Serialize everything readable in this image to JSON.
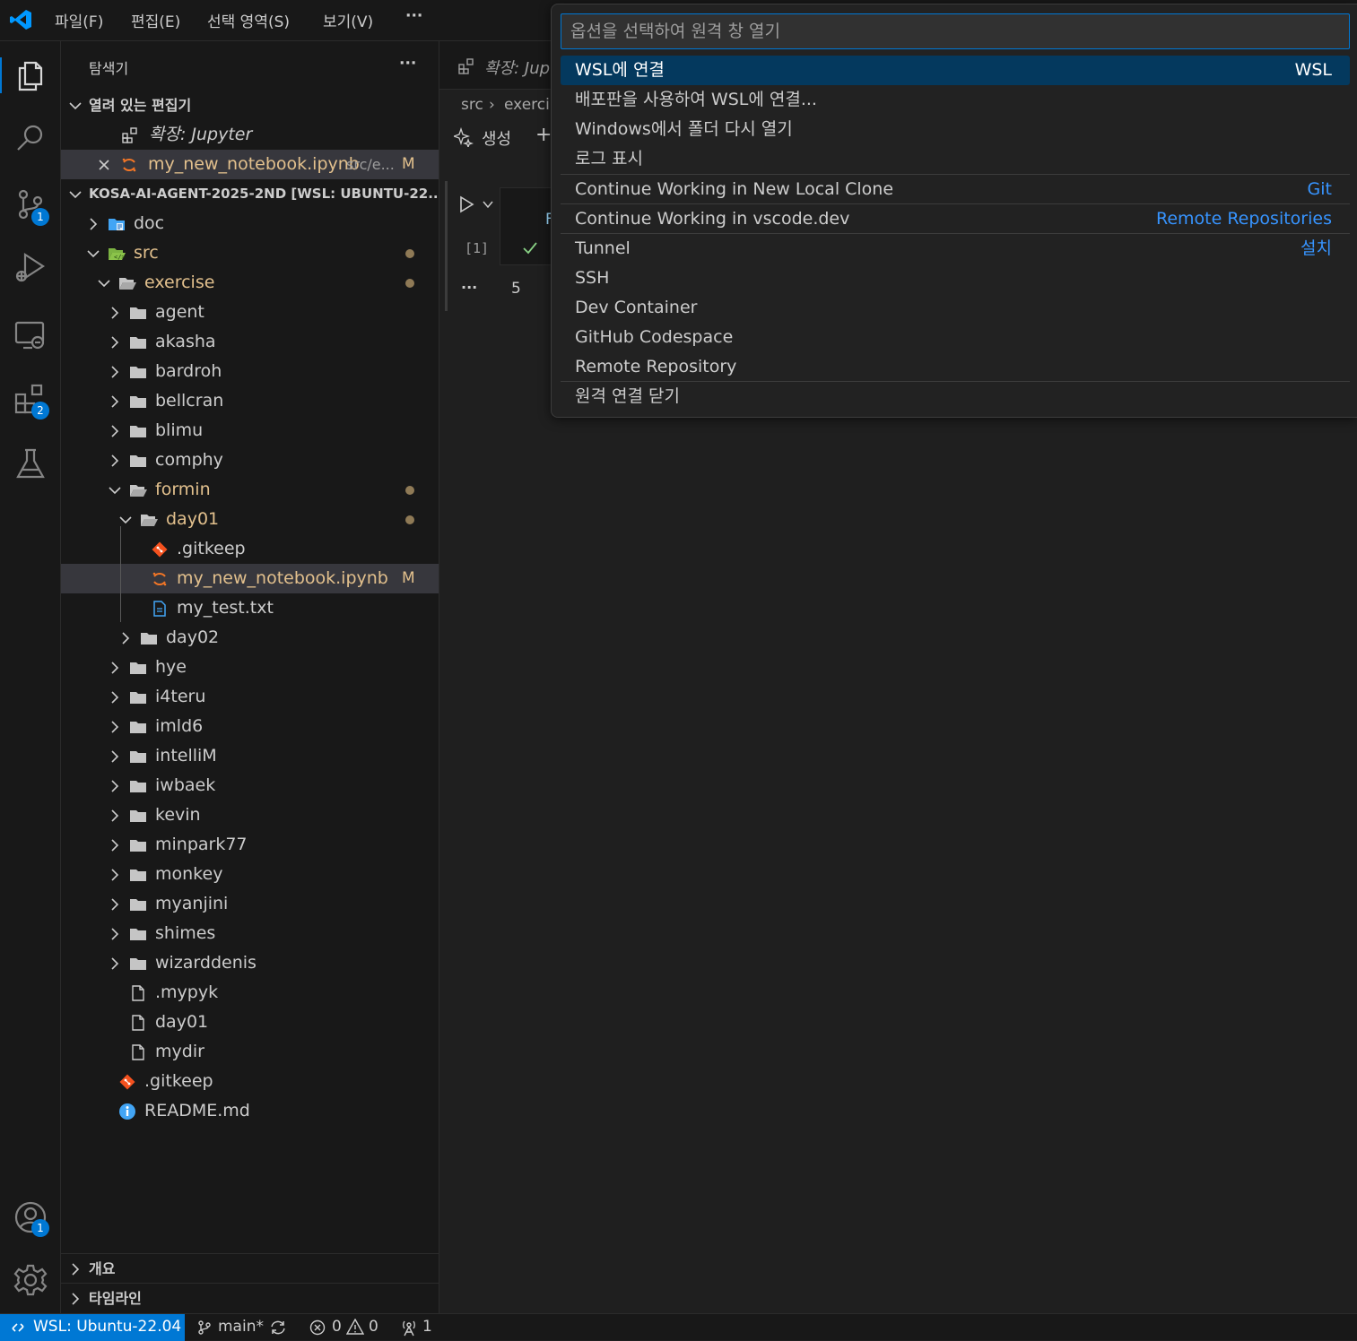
{
  "menu": {
    "items": [
      "파일(F)",
      "편집(E)",
      "선택 영역(S)",
      "보기(V)"
    ],
    "more": "···"
  },
  "activity": {
    "source_control_badge": "1",
    "extensions_badge": "2",
    "accounts_badge": "1"
  },
  "sidebar": {
    "title": "탐색기",
    "more": "···",
    "open_editors": {
      "header": "열려 있는 편집기",
      "items": [
        {
          "label": "확장: Jupyter",
          "path": "",
          "mark": ""
        },
        {
          "label": "my_new_notebook.ipynb",
          "path": "src/e...",
          "mark": "M"
        }
      ]
    },
    "workspace": {
      "header": "KOSA-AI-AGENT-2025-2ND [WSL: UBUNTU-22....",
      "tree": [
        {
          "label": "doc"
        },
        {
          "label": "src"
        },
        {
          "label": "exercise"
        },
        {
          "label": "agent"
        },
        {
          "label": "akasha"
        },
        {
          "label": "bardroh"
        },
        {
          "label": "bellcran"
        },
        {
          "label": "blimu"
        },
        {
          "label": "comphy"
        },
        {
          "label": "formin"
        },
        {
          "label": "day01"
        },
        {
          "label": ".gitkeep"
        },
        {
          "label": "my_new_notebook.ipynb",
          "mark": "M"
        },
        {
          "label": "my_test.txt"
        },
        {
          "label": "day02"
        },
        {
          "label": "hye"
        },
        {
          "label": "i4teru"
        },
        {
          "label": "imld6"
        },
        {
          "label": "intelliM"
        },
        {
          "label": "iwbaek"
        },
        {
          "label": "kevin"
        },
        {
          "label": "minpark77"
        },
        {
          "label": "monkey"
        },
        {
          "label": "myanjini"
        },
        {
          "label": "shimes"
        },
        {
          "label": "wizarddenis"
        },
        {
          "label": ".mypyk"
        },
        {
          "label": "day01"
        },
        {
          "label": "mydir"
        },
        {
          "label": ".gitkeep"
        },
        {
          "label": "README.md"
        }
      ]
    },
    "outline": "개요",
    "timeline": "타임라인"
  },
  "editor": {
    "tab_label": "확장: Jup",
    "breadcrumb": [
      "src",
      "exerci"
    ],
    "toolbar_generate": "생성",
    "toolbar_add": "+",
    "cell_exec_count": "[1]",
    "cell_output_partial": "F",
    "next_cell_more": "···",
    "next_cell_text": "5"
  },
  "quick_pick": {
    "placeholder": "옵션을 선택하여 원격 창 열기",
    "items": [
      {
        "label": "WSL에 연결",
        "desc": "WSL"
      },
      {
        "label": "배포판을 사용하여 WSL에 연결...",
        "desc": ""
      },
      {
        "label": "Windows에서 폴더 다시 열기",
        "desc": ""
      },
      {
        "label": "로그 표시",
        "desc": ""
      },
      {
        "label": "Continue Working in New Local Clone",
        "desc": "Git"
      },
      {
        "label": "Continue Working in vscode.dev",
        "desc": "Remote Repositories"
      },
      {
        "label": "Tunnel",
        "desc": "설치"
      },
      {
        "label": "SSH",
        "desc": ""
      },
      {
        "label": "Dev Container",
        "desc": ""
      },
      {
        "label": "GitHub Codespace",
        "desc": ""
      },
      {
        "label": "Remote Repository",
        "desc": ""
      },
      {
        "label": "원격 연결 닫기",
        "desc": ""
      }
    ]
  },
  "status": {
    "remote": "WSL: Ubuntu-22.04",
    "branch": "main*",
    "errors": "0",
    "warnings": "0",
    "ports": "1"
  },
  "colors": {
    "accent": "#0078d4",
    "modified": "#e2c08d",
    "link": "#3794ff",
    "selection": "#04395e"
  }
}
